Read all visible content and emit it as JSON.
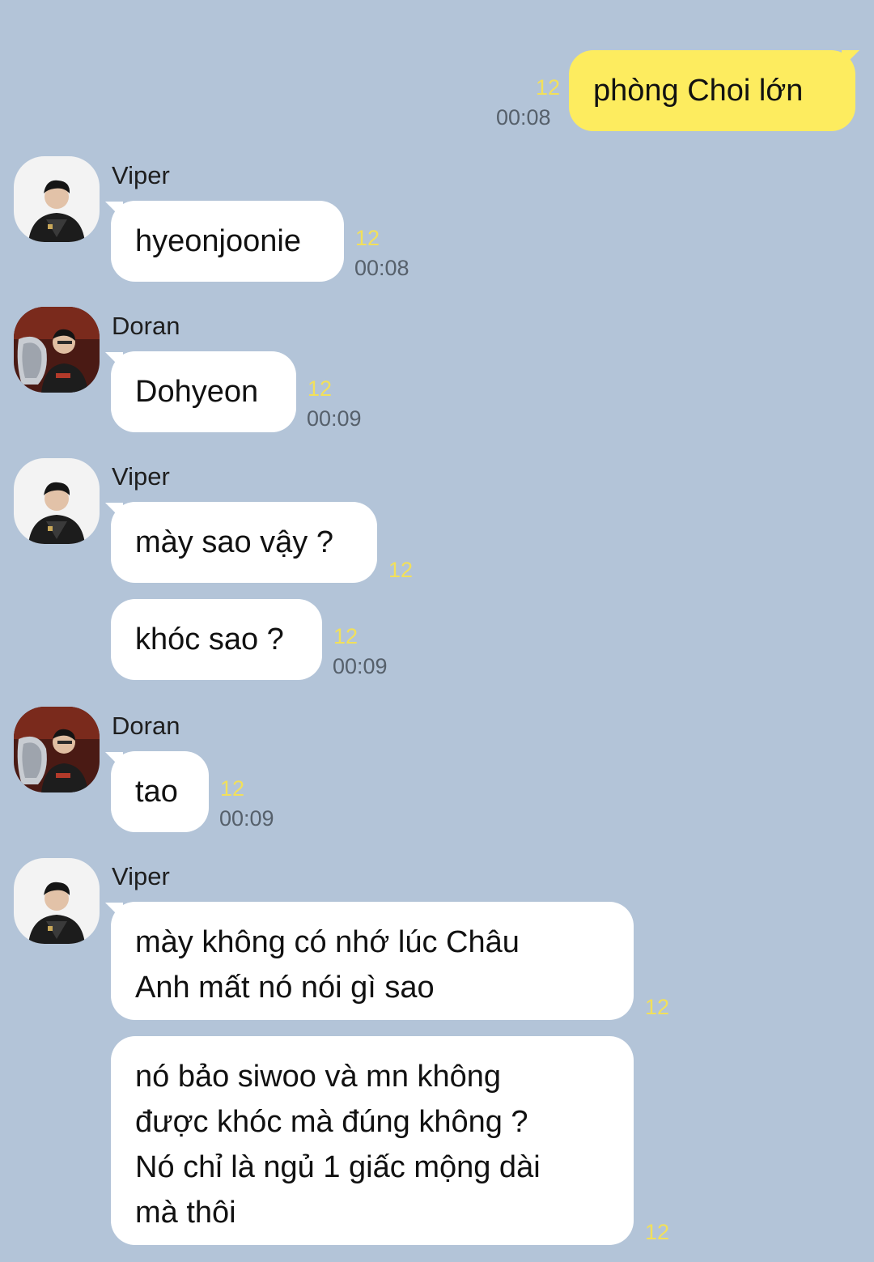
{
  "colors": {
    "background": "#b3c4d8",
    "incoming_bubble": "#ffffff",
    "outgoing_bubble": "#fdec5f",
    "unread_count": "#f2e05a",
    "timestamp": "#56606b"
  },
  "messages": [
    {
      "id": "m1",
      "direction": "out",
      "text": "phòng Choi lớn",
      "count": "12",
      "time": "00:08"
    },
    {
      "id": "m2",
      "direction": "in",
      "sender": "Viper",
      "avatar": "viper-avatar",
      "text": "hyeonjoonie",
      "count": "12",
      "time": "00:08"
    },
    {
      "id": "m3",
      "direction": "in",
      "sender": "Doran",
      "avatar": "doran-avatar",
      "text": "Dohyeon",
      "count": "12",
      "time": "00:09"
    },
    {
      "id": "m4",
      "direction": "in",
      "sender": "Viper",
      "avatar": "viper-avatar",
      "text": "mày sao vậy ?",
      "count": "12",
      "time": ""
    },
    {
      "id": "m5",
      "direction": "in",
      "sender": "",
      "text": "khóc sao ?",
      "count": "12",
      "time": "00:09"
    },
    {
      "id": "m6",
      "direction": "in",
      "sender": "Doran",
      "avatar": "doran-avatar",
      "text": "tao",
      "count": "12",
      "time": "00:09"
    },
    {
      "id": "m7",
      "direction": "in",
      "sender": "Viper",
      "avatar": "viper-avatar",
      "text": "mày không có nhớ lúc Châu\nAnh mất nó nói gì sao",
      "count": "12",
      "time": ""
    },
    {
      "id": "m8",
      "direction": "in",
      "sender": "",
      "text": "nó bảo siwoo và mn không\nđược khóc mà đúng không ?\nNó chỉ là ngủ 1 giấc mộng dài\nmà thôi",
      "count": "12",
      "time": ""
    }
  ]
}
